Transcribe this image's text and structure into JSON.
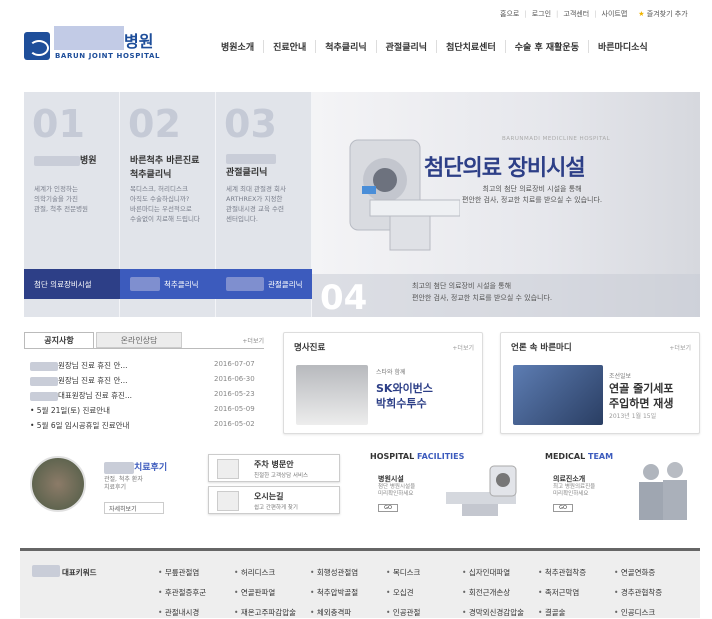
{
  "util": {
    "items": [
      "홈으로",
      "로그인",
      "고객센터",
      "사이트맵"
    ],
    "favorite": "즐겨찾기 추가"
  },
  "logo": {
    "kr": "병원",
    "en": "BARUN JOINT HOSPITAL"
  },
  "gnb": [
    "병원소개",
    "진료안내",
    "척추클리닉",
    "관절클리닉",
    "첨단치료센터",
    "수술 후 재활운동",
    "바른마디소식"
  ],
  "hero": {
    "cols": [
      {
        "num": "01",
        "title": "병원",
        "desc": "세계가 인정하는\n의학기술을 가진\n관절, 척추 전문병원",
        "bar": "첨단 의료장비시설"
      },
      {
        "num": "02",
        "title": "바른척추 바른진료\n척추클리닉",
        "desc": "목디스크, 허리디스크\n아직도 수술하십니까?\n바른마디는 우선적으로\n수술없이 치료해 드립니다",
        "bar": "척추클리닉"
      },
      {
        "num": "03",
        "title": "관절클리닉",
        "desc": "세계 최대 관절경 회사\nARTHREX가 지정한\n관절내시경 교육 수련\n센터입니다.",
        "bar": "관절클리닉"
      }
    ],
    "small": "BARUNMADI MEDICLINE HOSPITAL",
    "title": "첨단의료 장비시설",
    "sub": "최고의 첨단 의료장비 시설을 통해\n편안한 검사, 정교한 치료를 받으실 수 있습니다.",
    "num": "04",
    "band": "최고의 첨단 의료장비 시설을 통해\n편안한 검사, 정교한 치료를 받으실 수 있습니다."
  },
  "notice": {
    "tab1": "공지사항",
    "tab2": "온라인상담",
    "more": "+더보기",
    "rows": [
      {
        "title": "원장님 진료 휴진 안...",
        "date": "2016-07-07"
      },
      {
        "title": "원장님 진료 휴진 안...",
        "date": "2016-06-30"
      },
      {
        "title": "대표원장님 진료 휴진...",
        "date": "2016-05-23"
      },
      {
        "title": "• 5월 21일(토) 진료안내",
        "date": "2016-05-09"
      },
      {
        "title": "• 5월 6일 임시공휴일 진료안내",
        "date": "2016-05-02"
      }
    ]
  },
  "box1": {
    "head": "명사진료",
    "more": "+더보기",
    "small": "스타와 함께",
    "name": "SK와이번스\n박희수투수"
  },
  "box2": {
    "head": "언론 속 바른마디",
    "more": "+더보기",
    "src": "조선일보",
    "title": "연골 줄기세포\n주입하면 재생",
    "date": "2013년 1월 15일"
  },
  "review": {
    "title": "치료후기",
    "desc": "관절, 척추 환자\n치료후기",
    "btn": "자세히보기"
  },
  "quick": [
    {
      "l1": "주차 병문안",
      "l2": "친절한 고객상담 서비스"
    },
    {
      "l1": "오시는길",
      "l2": "쉽고 간편하게 찾기"
    }
  ],
  "facilities": {
    "head1": "HOSPITAL",
    "head2": "FACILITIES",
    "t": "병원시설",
    "d": "첨단 병원시설을\n미리확인하세요",
    "go": "GO"
  },
  "team": {
    "head1": "MEDICAL",
    "head2": "TEAM",
    "t": "의료진소개",
    "d": "최고 병원의료진을\n미리확인하세요",
    "go": "GO"
  },
  "keywords": {
    "label": "대표키워드",
    "items": [
      "무릎관절염",
      "허리디스크",
      "회행성관절염",
      "목디스크",
      "십자인대파열",
      "척추관협착증",
      "연골연화증",
      "후관절증후군",
      "연골판파열",
      "척추압박골절",
      "오십견",
      "회전근개손상",
      "족저근막염",
      "경추관협착증",
      "관절내시경",
      "재온고주파감압술",
      "체외충격파",
      "인공관절",
      "경막외신경감압술",
      "결골술",
      "인공디스크"
    ]
  }
}
